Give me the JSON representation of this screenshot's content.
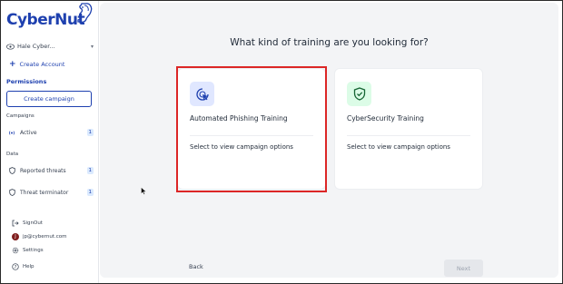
{
  "brand": {
    "logo_text": "CyberNut",
    "accent": "#1e40af"
  },
  "sidebar": {
    "org_name": "Hale Cyber...",
    "create_account": "Create Account",
    "permissions": "Permissions",
    "create_campaign": "Create campaign",
    "campaigns_label": "Campaigns",
    "active": {
      "label": "Active",
      "count": "1"
    },
    "data_label": "Data",
    "reported_threats": {
      "label": "Reported threats",
      "count": "1"
    },
    "threat_terminator": {
      "label": "Threat terminator",
      "count": "1"
    },
    "sign_out": "SignOut",
    "user_email": "jp@cybernut.com",
    "user_initial": "J",
    "settings": "Settings",
    "help": "Help"
  },
  "main": {
    "question": "What kind of training are you looking for?",
    "cards": [
      {
        "title": "Automated Phishing Training",
        "subtitle": "Select to view campaign options",
        "icon": "cursor-click-icon",
        "icon_bg": "#e0e7ff"
      },
      {
        "title": "CyberSecurity Training",
        "subtitle": "Select to view campaign options",
        "icon": "shield-check-icon",
        "icon_bg": "#dcfce7"
      }
    ],
    "back_label": "Back",
    "next_label": "Next"
  }
}
